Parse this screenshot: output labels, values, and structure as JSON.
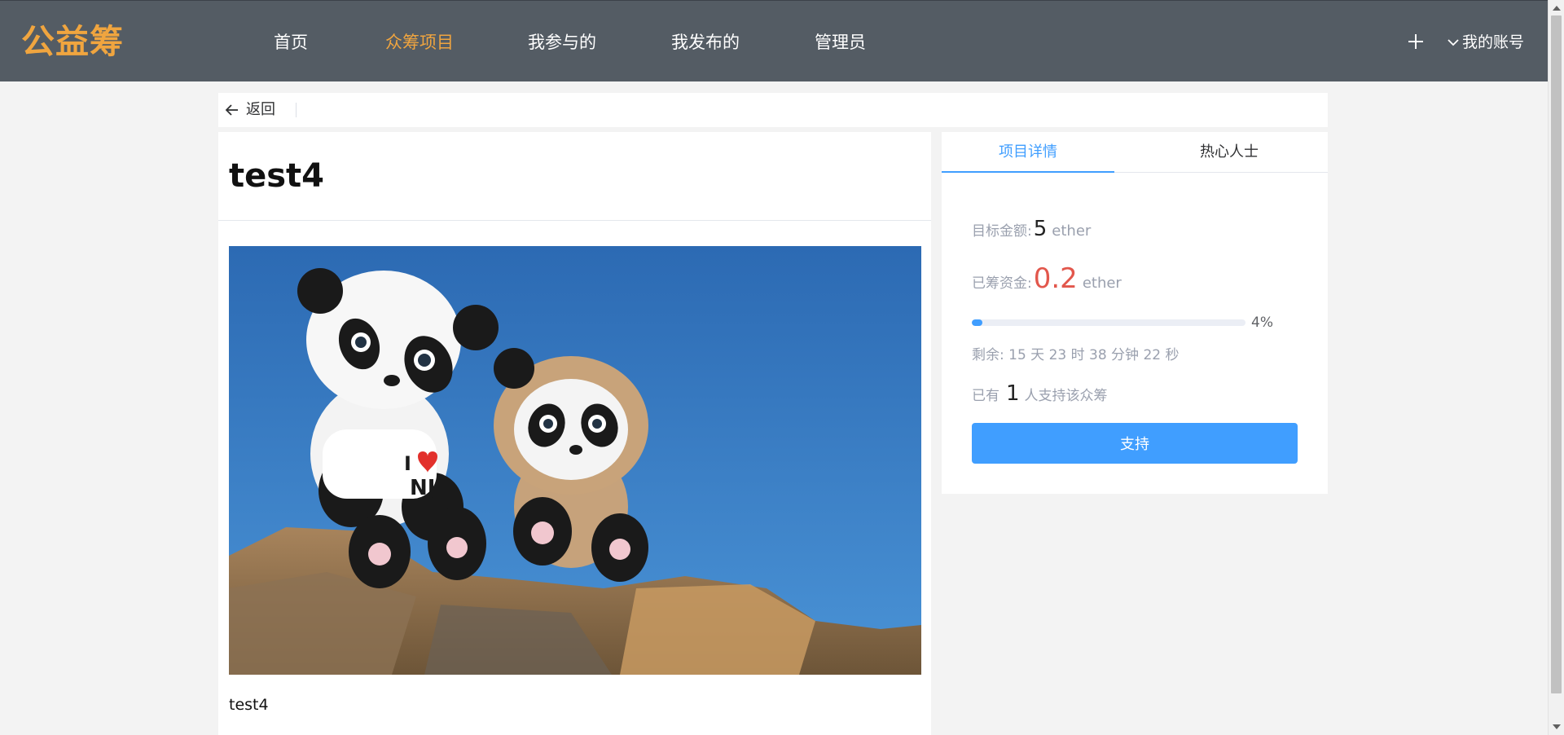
{
  "app": {
    "logo": "公益筹"
  },
  "nav": {
    "items": [
      {
        "label": "首页"
      },
      {
        "label": "众筹项目",
        "active": true
      },
      {
        "label": "我参与的"
      },
      {
        "label": "我发布的"
      },
      {
        "label": "管理员"
      }
    ],
    "account_label": "我的账号",
    "icons": {
      "add": "plus-icon",
      "account": "chevron-down-icon"
    }
  },
  "backbar": {
    "back_label": "返回",
    "icon": "arrow-left-icon"
  },
  "project": {
    "title": "test4",
    "description": "test4",
    "image_subject": "two plush panda toys sitting on a rock against a blue sky"
  },
  "info": {
    "tabs": [
      {
        "label": "项目详情",
        "active": true
      },
      {
        "label": "热心人士"
      }
    ],
    "target_label": "目标金额:",
    "target_value": "5",
    "raised_label": "已筹资金:",
    "raised_value": "0.2",
    "unit": "ether",
    "progress_percent": 4,
    "progress_text": "4%",
    "remaining_text": "剩余: 15 天 23 时 38 分钟 22 秒",
    "backers_prefix": "已有",
    "backers_count": "1",
    "backers_suffix": "人支持该众筹",
    "support_button": "支持"
  },
  "colors": {
    "nav_bg": "#545c64",
    "accent_orange": "#f0a53f",
    "primary_blue": "#409eff",
    "raised_red": "#e2574c"
  }
}
